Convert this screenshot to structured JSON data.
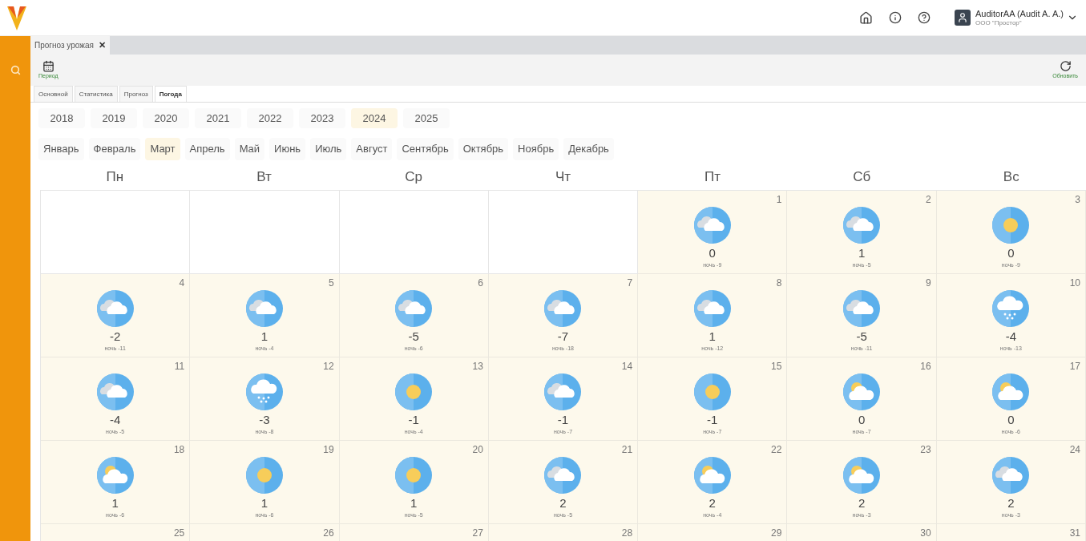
{
  "user": {
    "name": "AuditorAA (Audit A. A.)",
    "org": "ООО \"Простор\""
  },
  "doc_tabs": [
    {
      "label": "Прогноз урожая",
      "close": "✕"
    }
  ],
  "toolbar": {
    "left": {
      "label": "Период"
    },
    "right": {
      "label": "Обновить"
    }
  },
  "tabs": [
    {
      "label": "Основной",
      "selected": false
    },
    {
      "label": "Статистика",
      "selected": false
    },
    {
      "label": "Прогноз",
      "selected": false
    },
    {
      "label": "Погода",
      "selected": true
    }
  ],
  "years": [
    {
      "label": "2018",
      "selected": false
    },
    {
      "label": "2019",
      "selected": false
    },
    {
      "label": "2020",
      "selected": false
    },
    {
      "label": "2021",
      "selected": false
    },
    {
      "label": "2022",
      "selected": false
    },
    {
      "label": "2023",
      "selected": false
    },
    {
      "label": "2024",
      "selected": true
    },
    {
      "label": "2025",
      "selected": false
    }
  ],
  "months": [
    {
      "label": "Январь",
      "selected": false
    },
    {
      "label": "Февраль",
      "selected": false
    },
    {
      "label": "Март",
      "selected": true
    },
    {
      "label": "Апрель",
      "selected": false
    },
    {
      "label": "Май",
      "selected": false
    },
    {
      "label": "Июнь",
      "selected": false
    },
    {
      "label": "Июль",
      "selected": false
    },
    {
      "label": "Август",
      "selected": false
    },
    {
      "label": "Сентябрь",
      "selected": false
    },
    {
      "label": "Октябрь",
      "selected": false
    },
    {
      "label": "Ноябрь",
      "selected": false
    },
    {
      "label": "Декабрь",
      "selected": false
    }
  ],
  "weekdays": [
    "Пн",
    "Вт",
    "Ср",
    "Чт",
    "Пт",
    "Сб",
    "Вс"
  ],
  "days": [
    {
      "kind": "empty"
    },
    {
      "kind": "empty"
    },
    {
      "kind": "empty"
    },
    {
      "kind": "empty"
    },
    {
      "kind": "day",
      "day": "1",
      "weather": {
        "kind": "cloudy"
      },
      "temp": "0",
      "night": "ночь -9"
    },
    {
      "kind": "day",
      "day": "2",
      "weather": {
        "kind": "cloudy"
      },
      "temp": "1",
      "night": "ночь -5"
    },
    {
      "kind": "day",
      "day": "3",
      "weather": {
        "kind": "sun"
      },
      "temp": "0",
      "night": "ночь -9"
    },
    {
      "kind": "day",
      "day": "4",
      "weather": {
        "kind": "cloudy"
      },
      "temp": "-2",
      "night": "ночь -11"
    },
    {
      "kind": "day",
      "day": "5",
      "weather": {
        "kind": "cloudy"
      },
      "temp": "1",
      "night": "ночь -4"
    },
    {
      "kind": "day",
      "day": "6",
      "weather": {
        "kind": "cloudy"
      },
      "temp": "-5",
      "night": "ночь -6"
    },
    {
      "kind": "day",
      "day": "7",
      "weather": {
        "kind": "cloudy"
      },
      "temp": "-7",
      "night": "ночь -18"
    },
    {
      "kind": "day",
      "day": "8",
      "weather": {
        "kind": "cloudy"
      },
      "temp": "1",
      "night": "ночь -12"
    },
    {
      "kind": "day",
      "day": "9",
      "weather": {
        "kind": "cloudy"
      },
      "temp": "-5",
      "night": "ночь -11"
    },
    {
      "kind": "day",
      "day": "10",
      "weather": {
        "kind": "snow"
      },
      "temp": "-4",
      "night": "ночь -13"
    },
    {
      "kind": "day",
      "day": "11",
      "weather": {
        "kind": "cloudy"
      },
      "temp": "-4",
      "night": "ночь -5"
    },
    {
      "kind": "day",
      "day": "12",
      "weather": {
        "kind": "snow"
      },
      "temp": "-3",
      "night": "ночь -8"
    },
    {
      "kind": "day",
      "day": "13",
      "weather": {
        "kind": "sun"
      },
      "temp": "-1",
      "night": "ночь -4"
    },
    {
      "kind": "day",
      "day": "14",
      "weather": {
        "kind": "cloudy"
      },
      "temp": "-1",
      "night": "ночь -7"
    },
    {
      "kind": "day",
      "day": "15",
      "weather": {
        "kind": "sun"
      },
      "temp": "-1",
      "night": "ночь -7"
    },
    {
      "kind": "day",
      "day": "16",
      "weather": {
        "kind": "partly"
      },
      "temp": "0",
      "night": "ночь -7"
    },
    {
      "kind": "day",
      "day": "17",
      "weather": {
        "kind": "partly"
      },
      "temp": "0",
      "night": "ночь -6"
    },
    {
      "kind": "day",
      "day": "18",
      "weather": {
        "kind": "partly"
      },
      "temp": "1",
      "night": "ночь -6"
    },
    {
      "kind": "day",
      "day": "19",
      "weather": {
        "kind": "sun"
      },
      "temp": "1",
      "night": "ночь -6"
    },
    {
      "kind": "day",
      "day": "20",
      "weather": {
        "kind": "sun"
      },
      "temp": "1",
      "night": "ночь -5"
    },
    {
      "kind": "day",
      "day": "21",
      "weather": {
        "kind": "cloudy"
      },
      "temp": "2",
      "night": "ночь -5"
    },
    {
      "kind": "day",
      "day": "22",
      "weather": {
        "kind": "partly"
      },
      "temp": "2",
      "night": "ночь -4"
    },
    {
      "kind": "day",
      "day": "23",
      "weather": {
        "kind": "partly"
      },
      "temp": "2",
      "night": "ночь -3"
    },
    {
      "kind": "day",
      "day": "24",
      "weather": {
        "kind": "cloudy"
      },
      "temp": "2",
      "night": "ночь -3"
    },
    {
      "kind": "day",
      "day": "25"
    },
    {
      "kind": "day",
      "day": "26"
    },
    {
      "kind": "day",
      "day": "27"
    },
    {
      "kind": "day",
      "day": "28"
    },
    {
      "kind": "day",
      "day": "29"
    },
    {
      "kind": "day",
      "day": "30"
    },
    {
      "kind": "day",
      "day": "31"
    }
  ]
}
